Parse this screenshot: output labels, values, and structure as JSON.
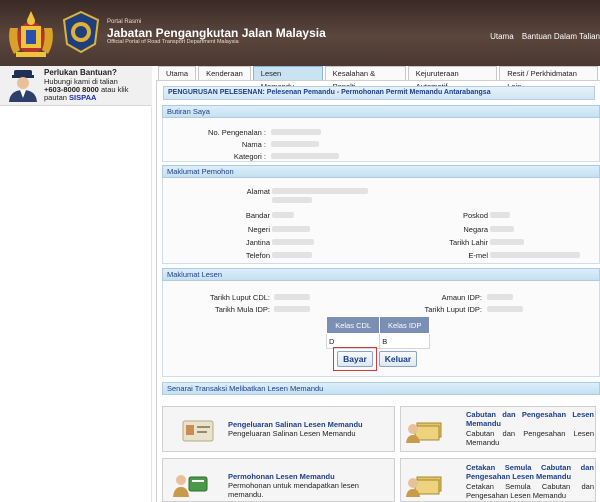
{
  "header": {
    "portal_small": "Portal Rasmi",
    "title": "Jabatan Pengangkutan Jalan Malaysia",
    "subtitle": "Official Portal of Road Transport Department Malaysia",
    "links": [
      "Utama",
      "Bantuan Dalam Talian"
    ]
  },
  "help": {
    "title": "Perlukan Bantuan?",
    "line1": "Hubungi kami di talian",
    "phone": "+603-8000 8000",
    "line2_tail": "atau klik",
    "line3_pre": "pautan",
    "link": "SISPAA"
  },
  "tabs": [
    {
      "label": "Utama",
      "active": false
    },
    {
      "label": "Kenderaan",
      "active": false
    },
    {
      "label": "Lesen Memandu",
      "active": true
    },
    {
      "label": "Kesalahan & Penalti",
      "active": false
    },
    {
      "label": "Kejuruteraan Automotif",
      "active": false
    },
    {
      "label": "Resit / Perkhidmatan Lain",
      "active": false
    }
  ],
  "page_heading": "PENGURUSAN PELESENAN: Pelesenan Pemandu - Permohonan Permit Memandu Antarabangsa",
  "butiran": {
    "title": "Butiran Saya",
    "labels": [
      "No. Pengenalan :",
      "Nama :",
      "Kategori :"
    ]
  },
  "maklumat_pemohon": {
    "title": "Maklumat Pemohon",
    "left_labels": [
      "Alamat",
      "Bandar",
      "Negeri",
      "Jantina",
      "Telefon"
    ],
    "right_labels": [
      "Poskod",
      "Negara",
      "Tarikh Lahir",
      "E-mel"
    ]
  },
  "maklumat_lesen": {
    "title": "Maklumat Lesen",
    "left_labels": [
      "Tarikh Luput CDL:",
      "Tarikh Mula IDP:"
    ],
    "right_labels": [
      "Amaun IDP:",
      "Tarikh Luput IDP:"
    ],
    "table_headers": [
      "Kelas CDL",
      "Kelas IDP"
    ],
    "table_row": [
      "D",
      "B"
    ]
  },
  "buttons": {
    "bayar": "Bayar",
    "keluar": "Keluar"
  },
  "transaksi": {
    "title": "Senarai Transaksi Melibatkan Lesen Memandu",
    "cards": [
      {
        "title": "Pengeluaran Salinan Lesen Memandu",
        "desc": "Pengeluaran Salinan Lesen Memandu"
      },
      {
        "title": "Cabutan dan Pengesahan Lesen Memandu",
        "desc": "Cabutan dan Pengesahan Lesen Memandu"
      },
      {
        "title": "Permohonan Lesen Memandu",
        "desc": "Permohonan untuk mendapatkan lesen memandu."
      },
      {
        "title": "Cetakan Semula Cabutan dan Pengesahan Lesen Memandu",
        "desc": "Cetakan Semula Cabutan dan Pengesahan Lesen Memandu"
      }
    ]
  },
  "colors": {
    "header_bg": "#4a3831",
    "section_bg": "#c6e0f1",
    "table_head": "#7b8fb5",
    "link": "#1a2ea8",
    "highlight_border": "#d23a3a"
  }
}
